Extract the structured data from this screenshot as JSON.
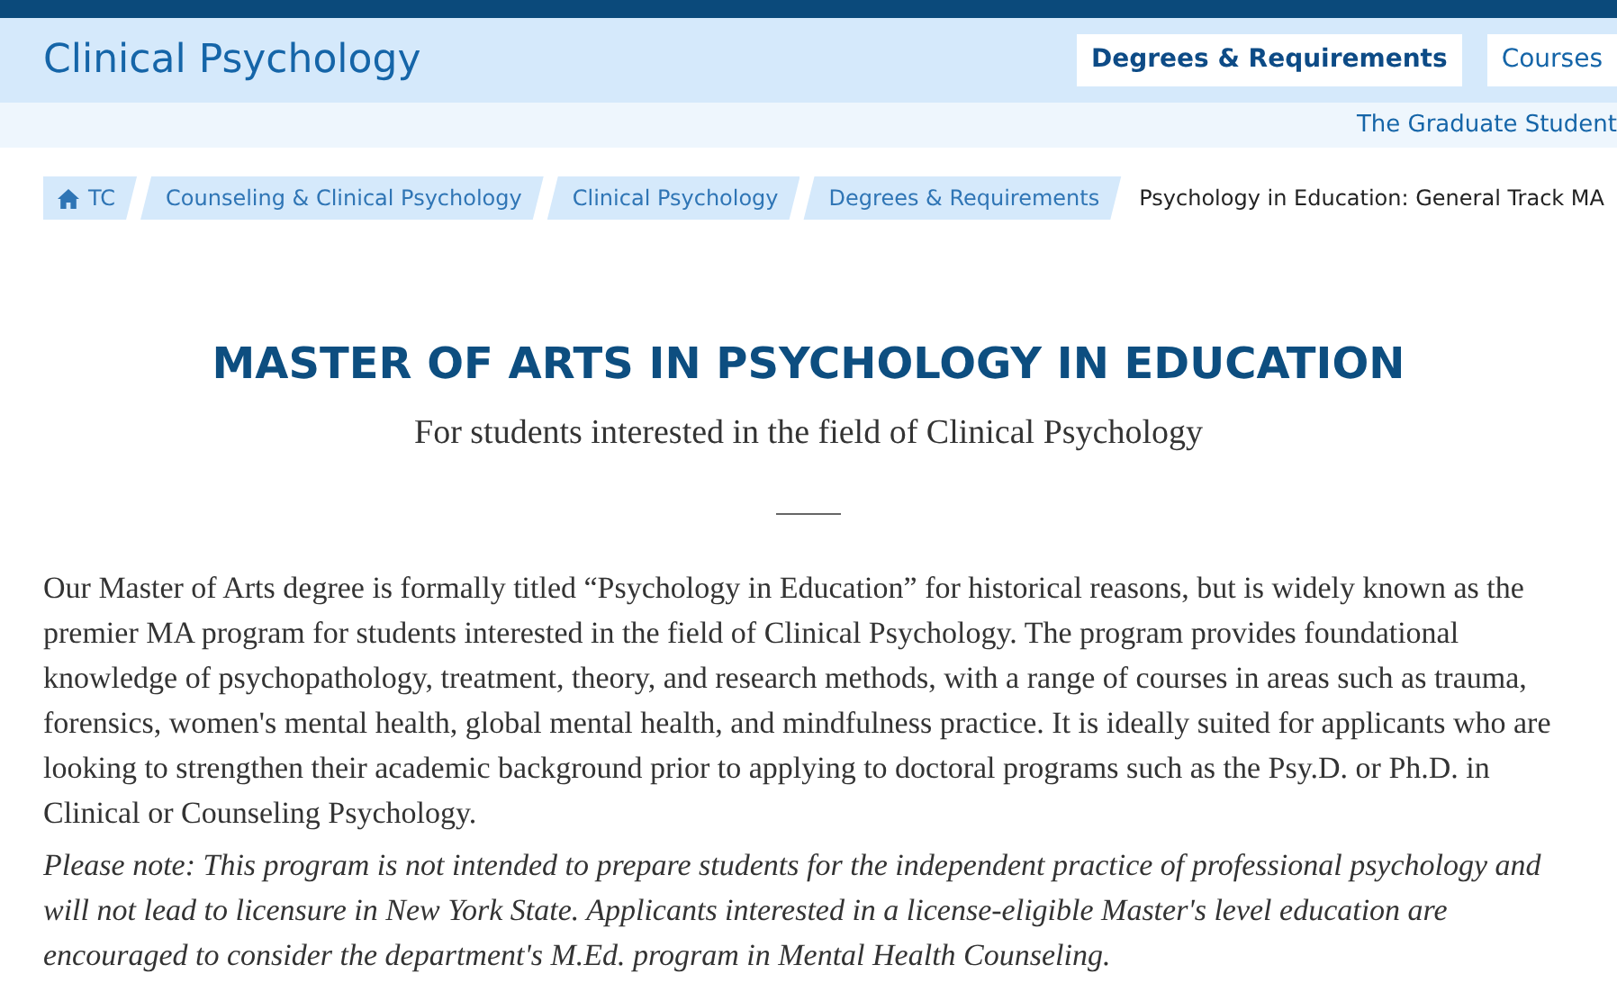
{
  "site_title": "Clinical Psychology",
  "nav": [
    {
      "label": "Degrees & Requirements",
      "selected": true
    },
    {
      "label": "Courses",
      "selected": false
    }
  ],
  "subnav": [
    "The Graduate Student"
  ],
  "breadcrumbs": [
    {
      "label": "TC",
      "kind": "home"
    },
    {
      "label": "Counseling & Clinical Psychology",
      "kind": "link"
    },
    {
      "label": "Clinical Psychology",
      "kind": "link"
    },
    {
      "label": "Degrees & Requirements",
      "kind": "link"
    },
    {
      "label": "Psychology in Education: General Track MA",
      "kind": "current"
    }
  ],
  "heading": "MASTER OF ARTS IN PSYCHOLOGY IN EDUCATION",
  "subheading": "For students interested in the field of Clinical Psychology",
  "paragraphs": [
    {
      "kind": "body",
      "text": "Our Master of Arts degree is formally titled “Psychology in Education” for historical reasons, but is widely known as the premier MA program for students interested in the field of Clinical Psychology. The program provides foundational knowledge of psychopathology, treatment, theory, and research methods, with a range of courses in areas such as trauma, forensics, women's mental health, global mental health, and mindfulness practice. It is ideally suited for applicants who are looking to strengthen their academic background prior to applying to doctoral programs such as the Psy.D. or Ph.D. in Clinical or Counseling Psychology."
    },
    {
      "kind": "note",
      "text": "Please note: This program is not intended to prepare students for the independent practice of professional psychology and will not lead to licensure in New York State. Applicants interested in a license-eligible Master's level education are encouraged to consider the department's M.Ed. program in Mental Health Counseling."
    }
  ]
}
